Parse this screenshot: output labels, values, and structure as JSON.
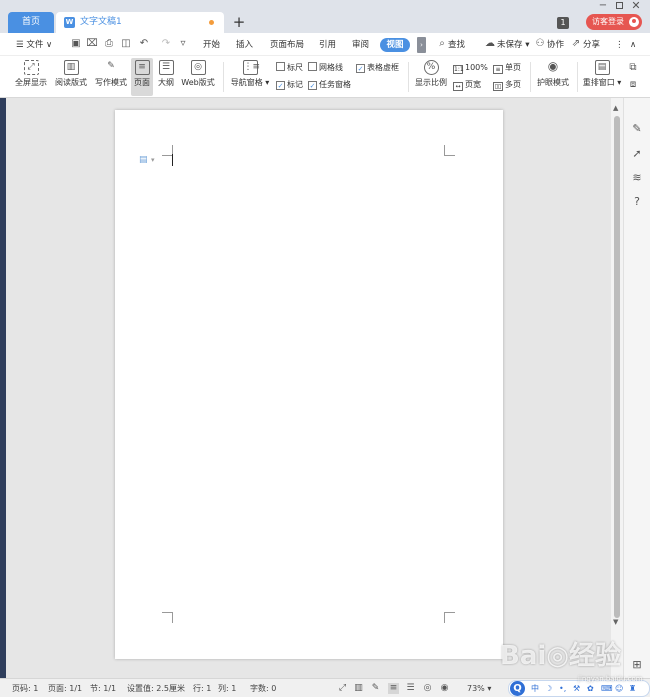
{
  "titlebar": {
    "home_tab": "首页",
    "doc_tab": "文字文稿1",
    "doc_icon_letter": "W",
    "add_tab_symbol": "+",
    "badge_count": "1",
    "login_label": "访客登录",
    "win_min": "−",
    "win_close": "✕"
  },
  "menubar": {
    "file_menu": "☰ 文件 ∨",
    "tabs": [
      "开始",
      "插入",
      "页面布局",
      "引用",
      "审阅",
      "视图"
    ],
    "active_tab": "视图",
    "search": "查找",
    "unsaved": "未保存 ▾",
    "collaborate": "协作",
    "share": "分享",
    "more": "⋮",
    "collapse": "∧",
    "quick_icons": [
      "save-icon",
      "format-painter-icon",
      "print-icon",
      "print-preview-icon",
      "undo-icon",
      "redo-icon",
      "customize-icon"
    ]
  },
  "ribbon": {
    "full_screen": "全屏显示",
    "read_layout": "阅读版式",
    "write_mode": "写作模式",
    "page": "页面",
    "outline": "大纲",
    "web_layout": "Web版式",
    "nav_pane": "导航窗格 ▾",
    "ruler": "标尺",
    "gridlines": "网格线",
    "table_borders": "表格虚框",
    "marks": "标记",
    "task_pane": "任务窗格",
    "zoom": "显示比例",
    "zoom_100": "100%",
    "page_width": "页宽",
    "single_page": "单页",
    "multi_page": "多页",
    "eye_mode": "护眼模式",
    "arrange_window": "重排窗口 ▾",
    "checked": {
      "ruler": false,
      "gridlines": false,
      "table_borders": true,
      "marks": true,
      "task_pane": true
    }
  },
  "statusbar": {
    "page_no": "页码: 1",
    "pages": "页面: 1/1",
    "section": "节: 1/1",
    "setting": "设置值: 2.5厘米",
    "row": "行: 1",
    "col": "列: 1",
    "words": "字数: 0",
    "zoom": "73% ▾"
  },
  "ime": {
    "logo": "Q",
    "mode": "中"
  },
  "watermark": {
    "text": "Bai◎经验",
    "sub": "jingyan.baidu.com"
  },
  "colors": {
    "accent": "#4a90e2",
    "login": "#e65651",
    "modified_dot": "#f39c3c"
  }
}
